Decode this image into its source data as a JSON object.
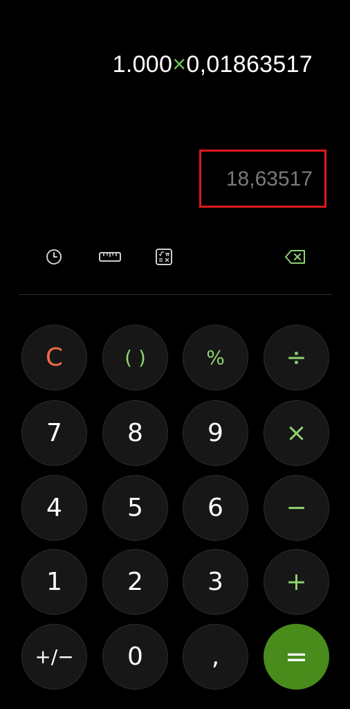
{
  "display": {
    "expression_left": "1.000",
    "expression_operator": "×",
    "expression_right": "0,01863517",
    "result": "18,63517"
  },
  "toolbar": {
    "history_icon": "clock-icon",
    "unit_converter_icon": "ruler-icon",
    "scientific_icon": "scientific-functions-icon",
    "backspace_icon": "backspace-icon"
  },
  "keys": {
    "clear": "C",
    "parentheses": "( )",
    "percent": "%",
    "divide": "÷",
    "seven": "7",
    "eight": "8",
    "nine": "9",
    "multiply": "×",
    "four": "4",
    "five": "5",
    "six": "6",
    "minus": "−",
    "one": "1",
    "two": "2",
    "three": "3",
    "plus": "+",
    "plus_minus": "+/−",
    "zero": "0",
    "decimal": ",",
    "equals": "="
  },
  "colors": {
    "accent_green": "#8fd371",
    "equals_green": "#4a8c1c",
    "clear_orange": "#f06b4a",
    "highlight_red": "#e0181e"
  }
}
